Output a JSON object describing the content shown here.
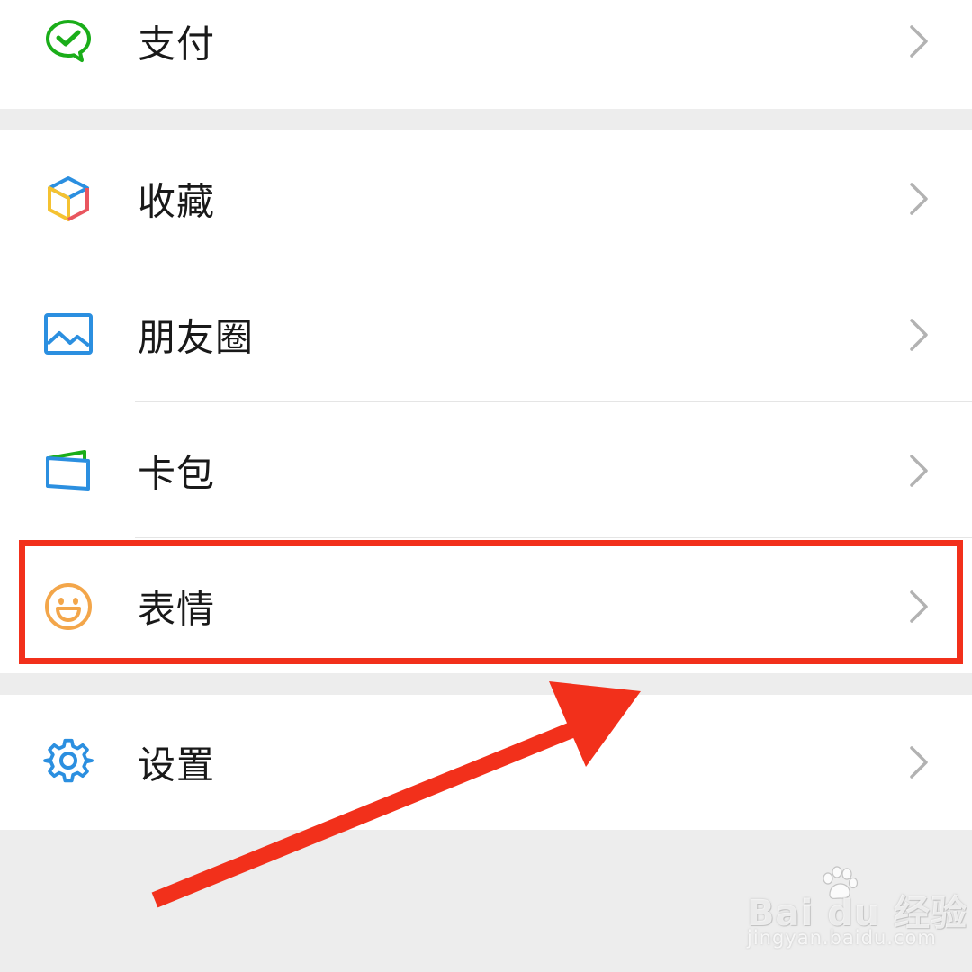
{
  "menu": {
    "pay_label": "支付",
    "favorites_label": "收藏",
    "moments_label": "朋友圈",
    "cards_label": "卡包",
    "stickers_label": "表情",
    "settings_label": "设置"
  },
  "icons": {
    "pay": "wechat-pay-check-icon",
    "favorites": "cube-icon",
    "moments": "picture-icon",
    "cards": "wallet-card-icon",
    "stickers": "smiley-face-icon",
    "settings": "gear-icon",
    "chevron": "chevron-right-icon"
  },
  "annotation": {
    "highlighted_item": "表情",
    "color": "#f2301b"
  },
  "watermark": {
    "brand": "Bai du 经验",
    "url": "jingyan.baidu.com"
  },
  "colors": {
    "background": "#ededed",
    "row_background": "#ffffff",
    "text": "#191919",
    "chevron": "#b2b2b2",
    "pay_green": "#1aad19",
    "settings_blue": "#2b8fe0",
    "sticker_orange": "#f3a64a"
  }
}
